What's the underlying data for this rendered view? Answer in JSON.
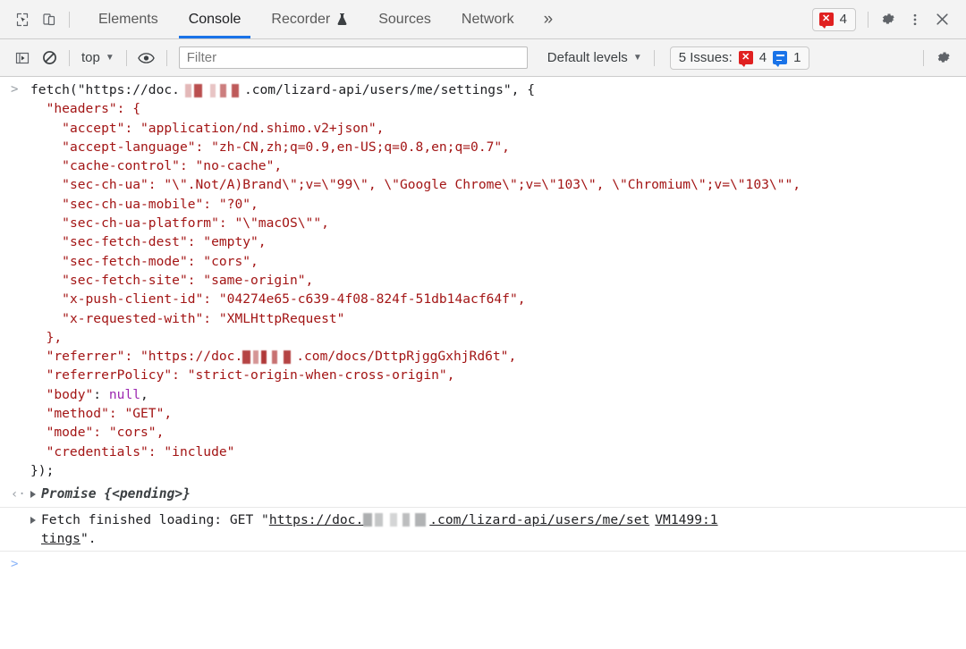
{
  "toolbar": {
    "icons": {
      "inspect": "inspect-element-icon",
      "device": "device-toolbar-icon"
    },
    "tabs": [
      {
        "label": "Elements",
        "active": false,
        "has_flask": false
      },
      {
        "label": "Console",
        "active": true,
        "has_flask": false
      },
      {
        "label": "Recorder",
        "active": false,
        "has_flask": true
      },
      {
        "label": "Sources",
        "active": false,
        "has_flask": false
      },
      {
        "label": "Network",
        "active": false,
        "has_flask": false
      }
    ],
    "more_tabs": "»",
    "error_count": "4",
    "settings_icon": "gear-icon",
    "more_options_icon": "kebab-menu-icon",
    "close_icon": "close-icon"
  },
  "filterbar": {
    "sidebar_icon": "show-console-sidebar-icon",
    "clear_icon": "clear-console-icon",
    "context": "top",
    "eye_icon": "live-expression-icon",
    "filter_placeholder": "Filter",
    "filter_value": "",
    "levels_label": "Default levels",
    "issues_label": "5 Issues:",
    "issues_error_count": "4",
    "issues_info_count": "1",
    "settings_icon": "console-settings-gear-icon"
  },
  "console": {
    "command": {
      "gutter": ">",
      "line1_pre": "fetch(\"https://doc.",
      "line1_post": ".com/lizard-api/users/me/settings\", {",
      "headers_open": "  \"headers\": {",
      "headers": [
        "    \"accept\": \"application/nd.shimo.v2+json\",",
        "    \"accept-language\": \"zh-CN,zh;q=0.9,en-US;q=0.8,en;q=0.7\",",
        "    \"cache-control\": \"no-cache\",",
        "    \"sec-ch-ua\": \"\\\".Not/A)Brand\\\";v=\\\"99\\\", \\\"Google Chrome\\\";v=\\\"103\\\", \\\"Chromium\\\";v=\\\"103\\\"\",",
        "    \"sec-ch-ua-mobile\": \"?0\",",
        "    \"sec-ch-ua-platform\": \"\\\"macOS\\\"\",",
        "    \"sec-fetch-dest\": \"empty\",",
        "    \"sec-fetch-mode\": \"cors\",",
        "    \"sec-fetch-site\": \"same-origin\",",
        "    \"x-push-client-id\": \"04274e65-c639-4f08-824f-51db14acf64f\",",
        "    \"x-requested-with\": \"XMLHttpRequest\""
      ],
      "headers_close": "  },",
      "referrer_pre": "  \"referrer\": \"https://doc.",
      "referrer_post": ".com/docs/DttpRjggGxhjRd6t\",",
      "tail": [
        "  \"referrerPolicy\": \"strict-origin-when-cross-origin\",",
        "  \"body\": null,",
        "  \"method\": \"GET\",",
        "  \"mode\": \"cors\",",
        "  \"credentials\": \"include\"",
        "});"
      ]
    },
    "result": {
      "gutter": "‹·",
      "text": "Promise {<pending>}"
    },
    "message": {
      "text_pre": "Fetch finished loading: GET \"",
      "url_pre": "https://doc.",
      "url_post": ".com/lizard-api/users/me/set",
      "url_wrap": "tings",
      "text_post": "\".",
      "source": "VM1499:1"
    },
    "prompt": ">"
  },
  "colors": {
    "accent": "#1a73e8",
    "error": "#e02020",
    "string": "#a31515",
    "keyword": "#9c27b0",
    "toolbar_bg": "#f3f3f3"
  }
}
